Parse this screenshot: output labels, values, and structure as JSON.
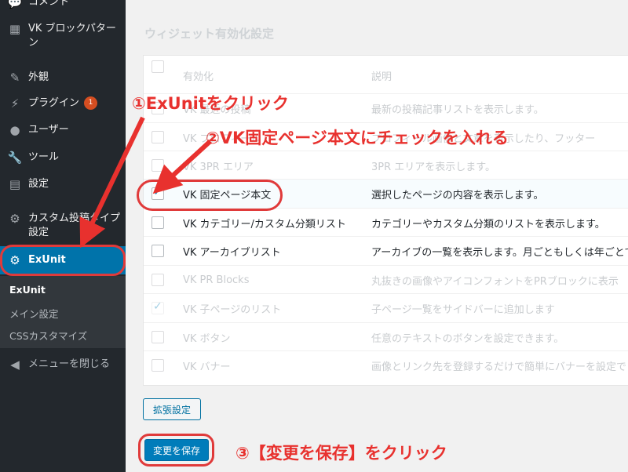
{
  "sidebar": {
    "items": [
      {
        "label": "コメント",
        "icon": "comment-icon"
      },
      {
        "label": "VK ブロックパターン",
        "icon": "grid-icon"
      },
      {
        "label": "外観",
        "icon": "brush-icon"
      },
      {
        "label": "プラグイン",
        "icon": "plugin-icon",
        "badge": "1"
      },
      {
        "label": "ユーザー",
        "icon": "user-icon"
      },
      {
        "label": "ツール",
        "icon": "wrench-icon"
      },
      {
        "label": "設定",
        "icon": "settings-icon"
      },
      {
        "label": "カスタム投稿タイプ設定",
        "icon": "gear-icon"
      },
      {
        "label": "ExUnit",
        "icon": "gear-icon"
      }
    ],
    "submenu": [
      "ExUnit",
      "メイン設定",
      "CSSカスタマイズ"
    ],
    "collapse": "メニューを閉じる"
  },
  "main": {
    "section_title": "ウィジェット有効化設定",
    "columns": {
      "enabled": "有効化",
      "description": "説明"
    },
    "rows": [
      {
        "name": "VK 最近の投稿",
        "desc": "最新の投稿記事リストを表示します。",
        "state": "faded"
      },
      {
        "name": "VK プロフィール",
        "desc": "プロフィール画像と文章を表示したり、フッター",
        "state": "faded"
      },
      {
        "name": "VK 3PR エリア",
        "desc": "3PR エリアを表示します。",
        "state": "faded"
      },
      {
        "name": "VK 固定ページ本文",
        "desc": "選択したページの内容を表示します。",
        "state": "checked"
      },
      {
        "name": "VK カテゴリー/カスタム分類リスト",
        "desc": "カテゴリーやカスタム分類のリストを表示します。",
        "state": "active"
      },
      {
        "name": "VK アーカイブリスト",
        "desc": "アーカイブの一覧を表示します。月ごともしくは年ごとで",
        "state": "active"
      },
      {
        "name": "VK PR Blocks",
        "desc": "丸抜きの画像やアイコンフォントをPRブロックに表示",
        "state": "faded"
      },
      {
        "name": "VK 子ページのリスト",
        "desc": "子ページ一覧をサイドバーに追加します",
        "state": "faded-checked"
      },
      {
        "name": "VK ボタン",
        "desc": "任意のテキストのボタンを設定できます。",
        "state": "faded"
      },
      {
        "name": "VK バナー",
        "desc": "画像とリンク先を登録するだけで簡単にバナーを設定で",
        "state": "faded"
      }
    ],
    "extend_button": "拡張設定",
    "save_button": "変更を保存"
  },
  "annotations": {
    "step1": "①ExUnitをクリック",
    "step2": "②VK固定ページ本文にチェックを入れる",
    "step3": "③【変更を保存】をクリック",
    "color": "#e8312e"
  }
}
